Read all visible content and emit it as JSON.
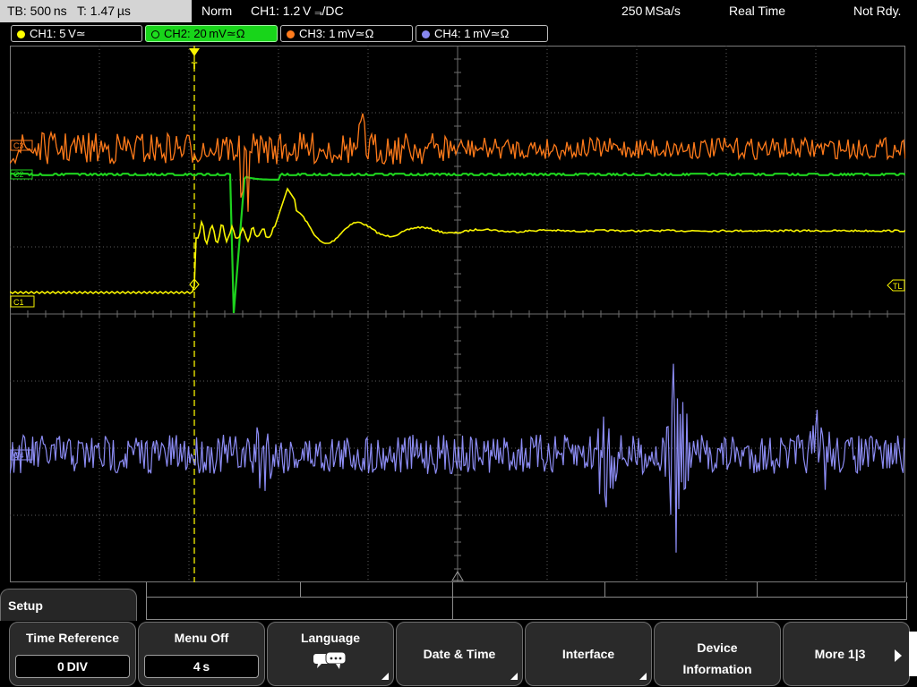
{
  "status_bar": {
    "timebase": "TB: 500 ns   T: 1.47 µs",
    "trigger_mode": "Norm",
    "trigger_info": "CH1: 1.2 V ⫬/DC",
    "sample_rate": "250 MSa/s",
    "acquisition": "Real Time",
    "status": "Not Rdy."
  },
  "channels": [
    {
      "label": "CH1: 5 V≃",
      "color": "#ffff00",
      "active": false
    },
    {
      "label": "CH2: 20 mV≃Ω",
      "color": "#1ee01e",
      "active": true
    },
    {
      "label": "CH3: 1 mV≃Ω",
      "color": "#ff7b1c",
      "active": false
    },
    {
      "label": "CH4: 1 mV≃Ω",
      "color": "#8888f0",
      "active": false
    }
  ],
  "markers": {
    "c3": "C3",
    "c2": "C2",
    "c1": "C1",
    "c4": "C4",
    "trigger_level": "TL",
    "trigger_pos": "T"
  },
  "colors": {
    "ch1": "#f8f400",
    "ch2": "#1ed21e",
    "ch3": "#ff7a1a",
    "ch4": "#8c8cf4",
    "grid": "#6e6e6e"
  },
  "menu": {
    "title": "Setup",
    "softkeys": [
      {
        "label": "Time Reference",
        "value": "0 DIV"
      },
      {
        "label": "Menu Off",
        "value": "4 s"
      },
      {
        "label": "Language",
        "icon": "speech-bubbles-icon"
      },
      {
        "label": "Date & Time"
      },
      {
        "label": "Interface"
      },
      {
        "label_line1": "Device",
        "label_line2": "Information"
      },
      {
        "label": "More 1|3"
      }
    ]
  }
}
